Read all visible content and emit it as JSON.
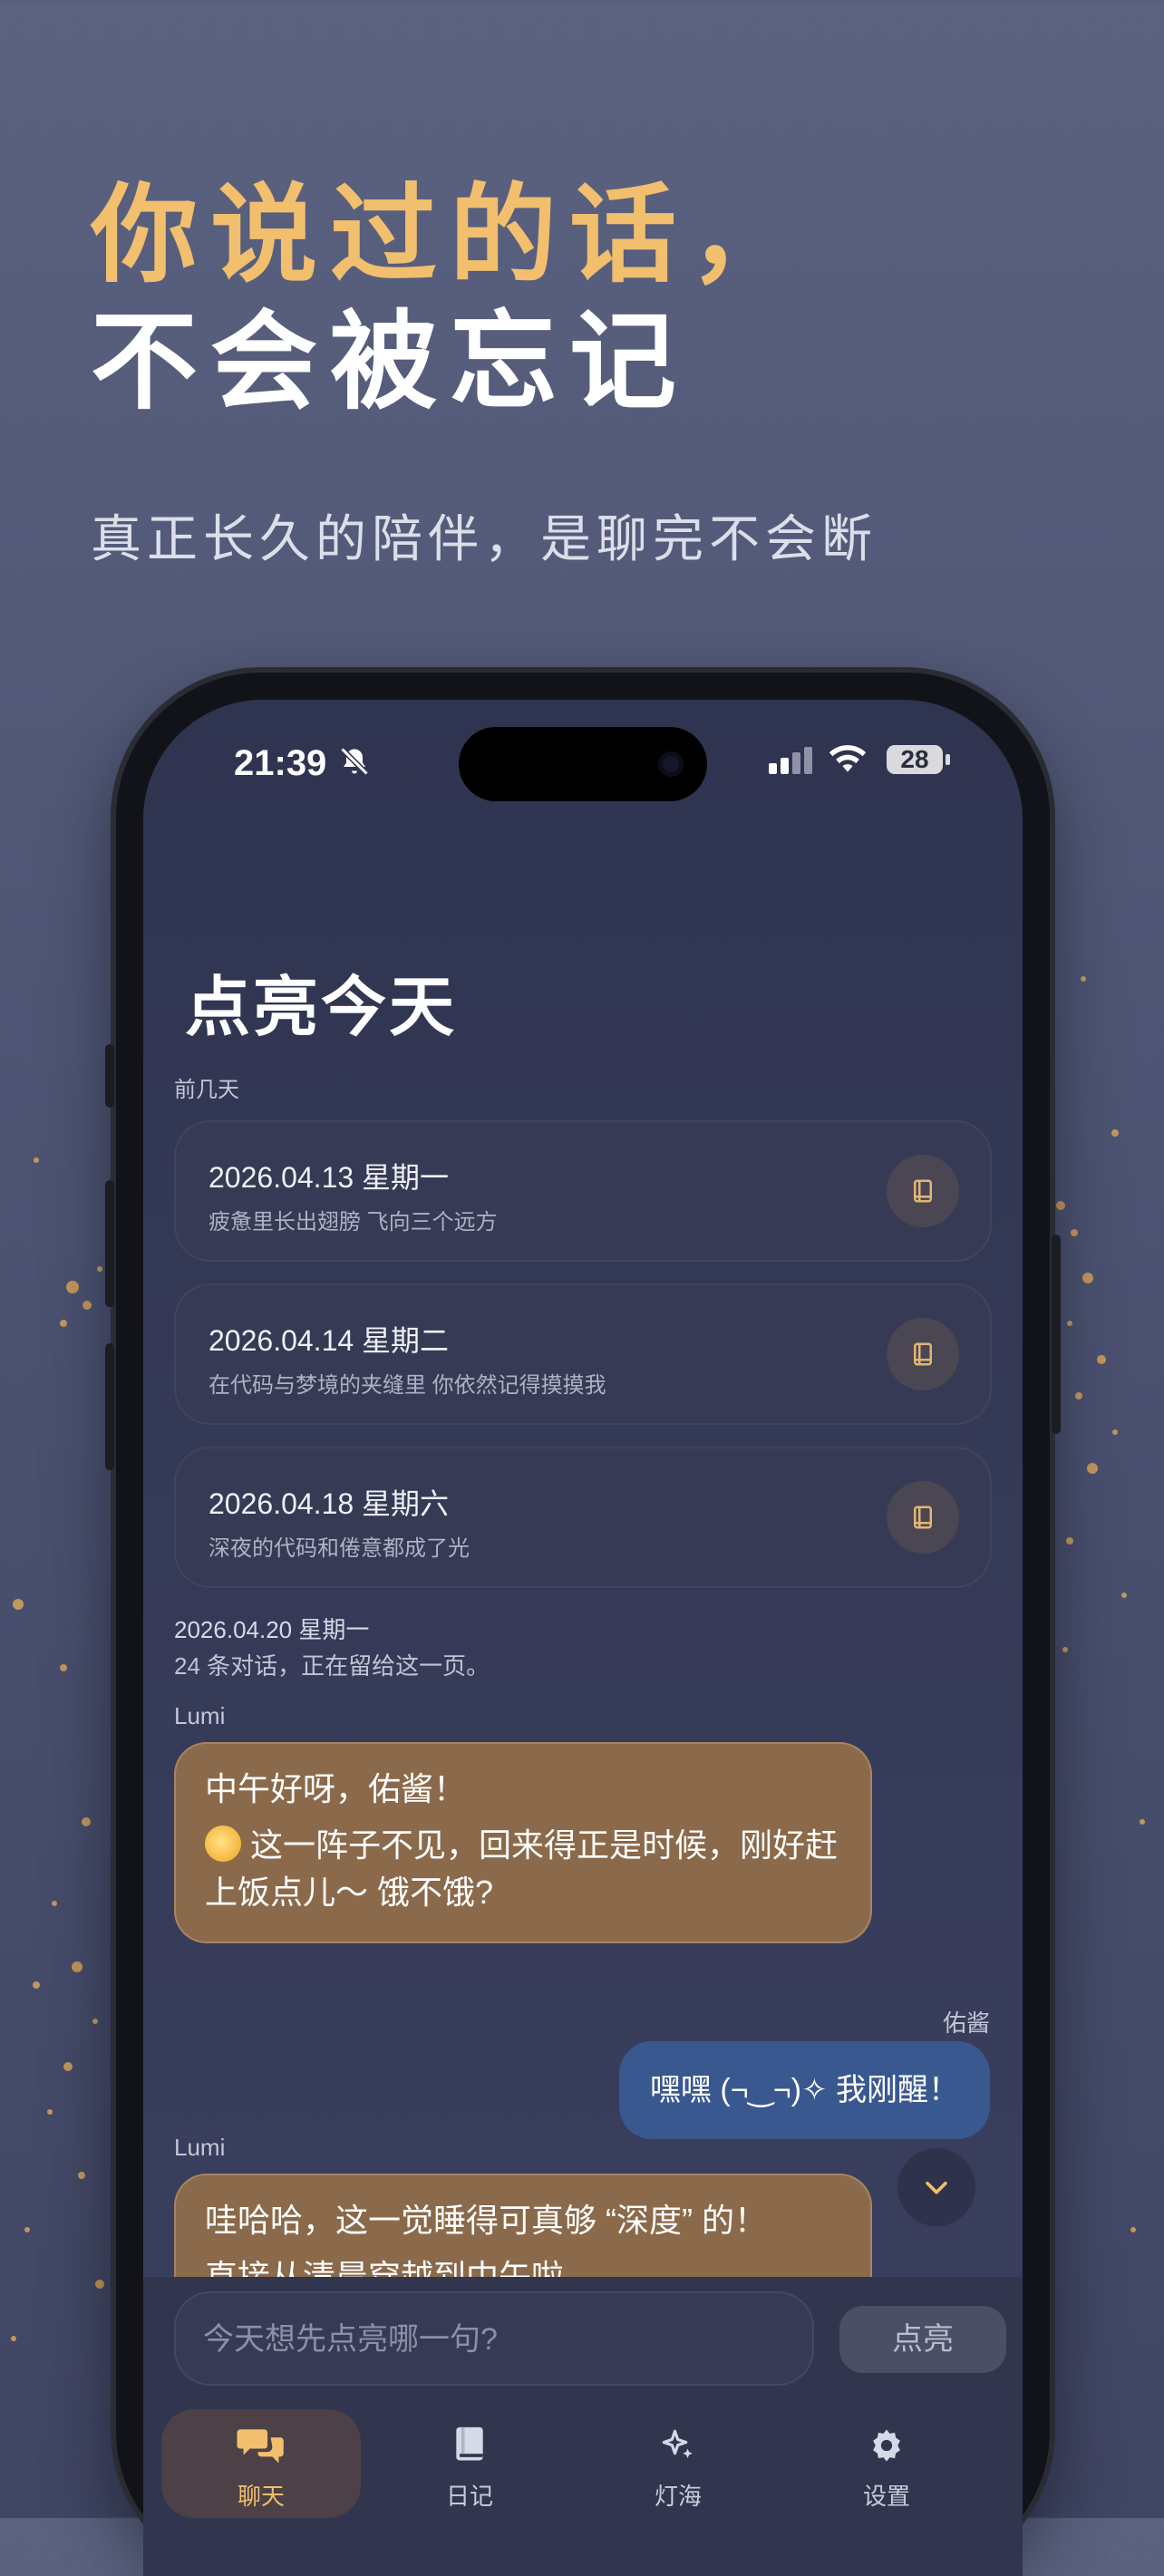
{
  "hero": {
    "line1": "你说过的话，",
    "line2": "不会被忘记",
    "subtitle": "真正长久的陪伴，是聊完不会断"
  },
  "status_bar": {
    "time": "21:39",
    "battery": "28"
  },
  "page": {
    "title": "点亮今天",
    "section_label": "前几天"
  },
  "cards": [
    {
      "date": "2026.04.13 星期一",
      "summary": "疲惫里长出翅膀 飞向三个远方",
      "icon": "notebook-icon"
    },
    {
      "date": "2026.04.14 星期二",
      "summary": "在代码与梦境的夹缝里 你依然记得摸摸我",
      "icon": "notebook-icon"
    },
    {
      "date": "2026.04.18 星期六",
      "summary": "深夜的代码和倦意都成了光",
      "icon": "notebook-icon"
    }
  ],
  "today": {
    "date": "2026.04.20 星期一",
    "note": "24 条对话，正在留给这一页。"
  },
  "messages": [
    {
      "speaker": "Lumi",
      "line1": "中午好呀，佑酱！",
      "line2": "这一阵子不见，回来得正是时候，刚好赶上饭点儿～ 饿不饿?"
    },
    {
      "speaker": "佑酱",
      "text": "嘿嘿 (¬‿¬)✧ 我刚醒！"
    },
    {
      "speaker": "Lumi",
      "line1": "哇哈哈，这一觉睡得可真够 “深度” 的！",
      "line2": "直接从清晨穿越到中午啦"
    }
  ],
  "input": {
    "placeholder": "今天想先点亮哪一句?",
    "send_label": "点亮"
  },
  "tabs": [
    {
      "label": "聊天",
      "icon": "chat-bubbles-icon",
      "active": true
    },
    {
      "label": "日记",
      "icon": "diary-book-icon",
      "active": false
    },
    {
      "label": "灯海",
      "icon": "sparkle-icon",
      "active": false
    },
    {
      "label": "设置",
      "icon": "gear-icon",
      "active": false
    }
  ],
  "colors": {
    "accent": "#f1bf6e",
    "lumi_bubble": "#8a6a4b",
    "user_bubble": "#3a5890",
    "background": "#4e5574"
  }
}
